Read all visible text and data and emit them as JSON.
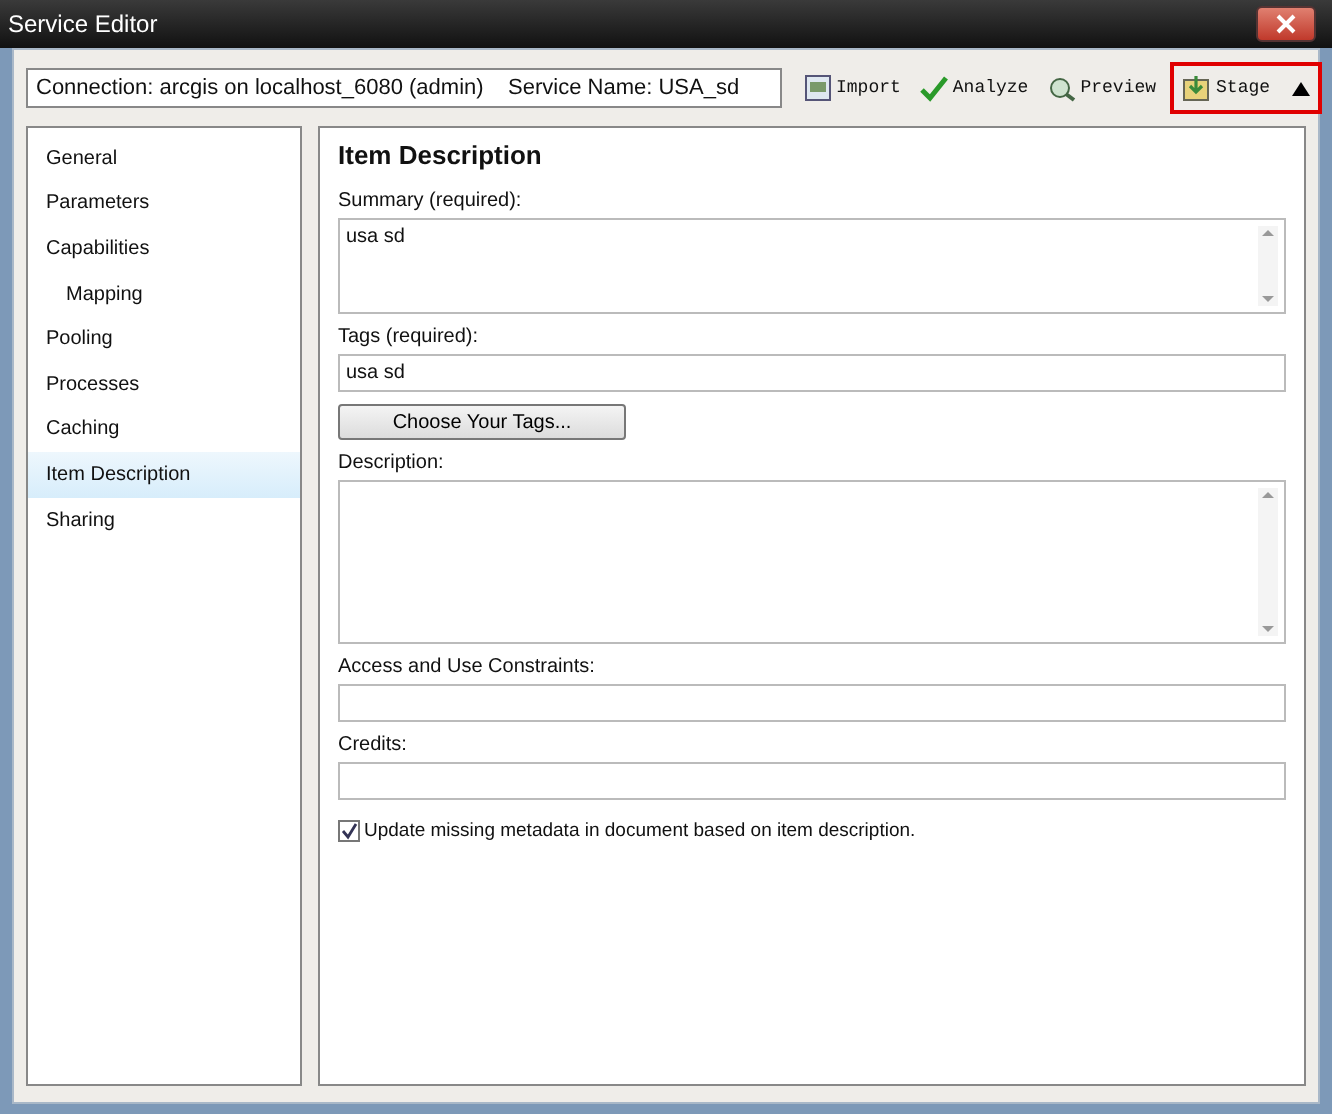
{
  "window": {
    "title": "Service Editor"
  },
  "connection": "Connection: arcgis on localhost_6080 (admin)    Service Name: USA_sd",
  "tools": [
    {
      "kind": "import",
      "label": "Import",
      "highlighted": false
    },
    {
      "kind": "analyze",
      "label": "Analyze",
      "highlighted": false
    },
    {
      "kind": "preview",
      "label": "Preview",
      "highlighted": false
    },
    {
      "kind": "stage",
      "label": "Stage",
      "highlighted": true
    }
  ],
  "sidebar": {
    "items": [
      {
        "label": "General",
        "selected": false
      },
      {
        "label": "Parameters",
        "selected": false
      },
      {
        "label": "Capabilities",
        "selected": false,
        "children": [
          {
            "label": "Mapping",
            "selected": false
          }
        ]
      },
      {
        "label": "Pooling",
        "selected": false
      },
      {
        "label": "Processes",
        "selected": false
      },
      {
        "label": "Caching",
        "selected": false
      },
      {
        "label": "Item Description",
        "selected": true
      },
      {
        "label": "Sharing",
        "selected": false
      }
    ]
  },
  "panel": {
    "title": "Item Description",
    "fields": [
      {
        "kind": "textarea",
        "label": "Summary (required):",
        "value": "usa sd",
        "tall": false
      },
      {
        "kind": "input",
        "label": "Tags (required):",
        "value": "usa sd"
      },
      {
        "kind": "button",
        "label": "Choose Your Tags..."
      },
      {
        "kind": "textarea",
        "label": "Description:",
        "tall": true
      },
      {
        "kind": "input",
        "label": "Access and Use Constraints:"
      },
      {
        "kind": "input",
        "label": "Credits:"
      },
      {
        "kind": "checkbox",
        "label": "Update missing metadata in document based on item description.",
        "checked": true
      }
    ]
  }
}
